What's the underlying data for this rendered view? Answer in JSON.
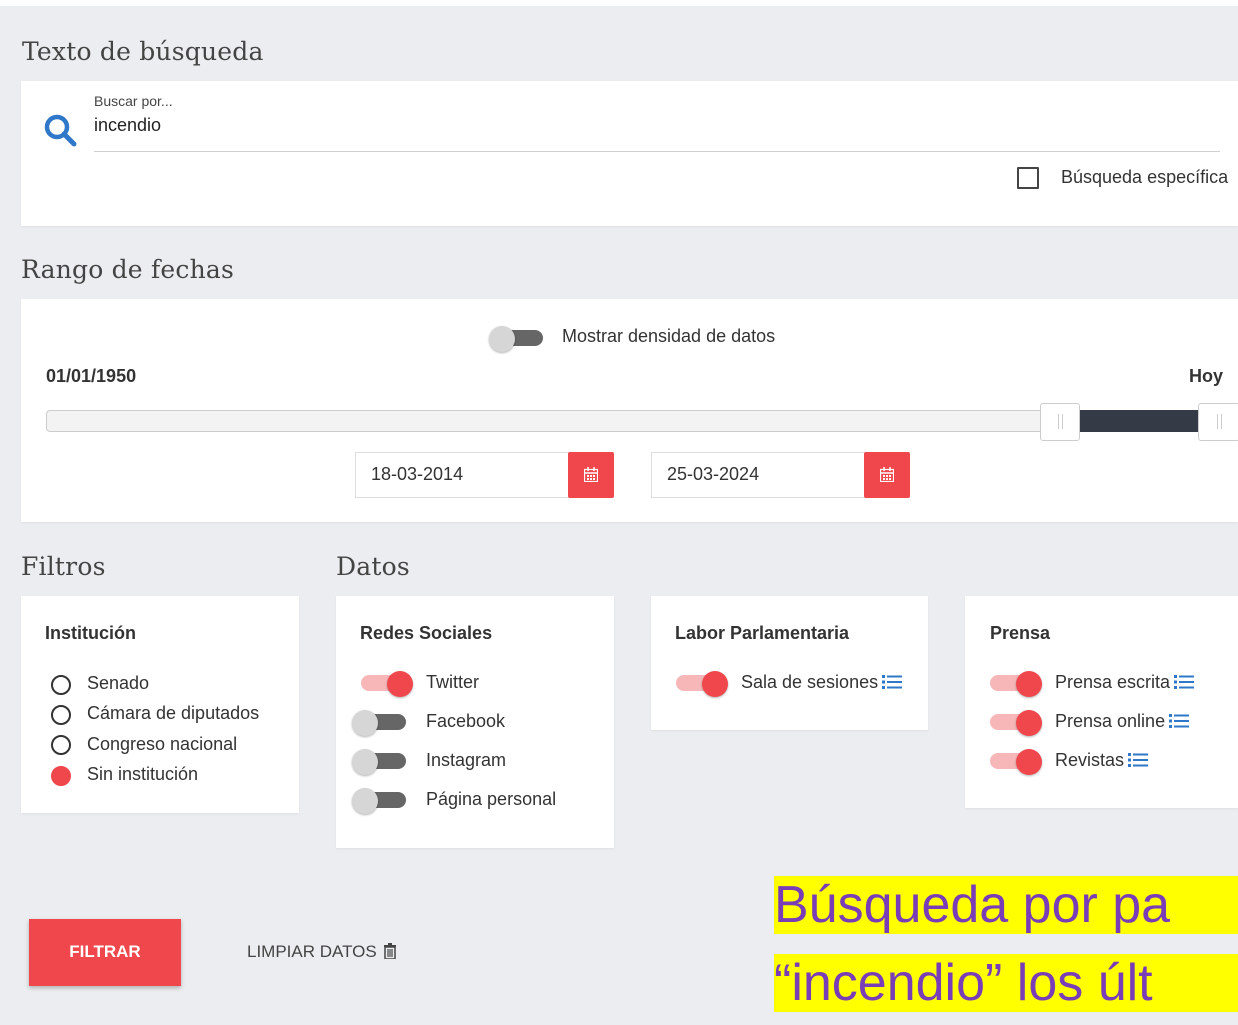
{
  "search": {
    "section_title": "Texto de búsqueda",
    "field_label": "Buscar por...",
    "value": "incendio",
    "specific_label": "Búsqueda específica"
  },
  "dates": {
    "section_title": "Rango de fechas",
    "density_label": "Mostrar densidad de datos",
    "min_label": "01/01/1950",
    "max_label": "Hoy",
    "start": "18-03-2014",
    "end": "25-03-2024"
  },
  "filters": {
    "section_title": "Filtros",
    "card_title": "Institución",
    "options": [
      "Senado",
      "Cámara de diputados",
      "Congreso nacional",
      "Sin institución"
    ],
    "selected": "Sin institución"
  },
  "datos": {
    "section_title": "Datos",
    "redes": {
      "title": "Redes Sociales",
      "items": [
        {
          "label": "Twitter",
          "on": true
        },
        {
          "label": "Facebook",
          "on": false
        },
        {
          "label": "Instagram",
          "on": false
        },
        {
          "label": "Página personal",
          "on": false
        }
      ]
    },
    "labor": {
      "title": "Labor Parlamentaria",
      "items": [
        {
          "label": "Sala de sesiones",
          "on": true
        }
      ]
    },
    "prensa": {
      "title": "Prensa",
      "items": [
        {
          "label": "Prensa escrita",
          "on": true
        },
        {
          "label": "Prensa online",
          "on": true
        },
        {
          "label": "Revistas",
          "on": true
        }
      ]
    }
  },
  "actions": {
    "filter_label": "FILTRAR",
    "clear_label": "LIMPIAR DATOS"
  },
  "caption": {
    "line1": "Búsqueda por pa",
    "line2": "“incendio” los últ"
  },
  "colors": {
    "accent": "#f0474c",
    "search_icon": "#2f78c9",
    "caption_bg": "#ffff00",
    "caption_text": "#7a3db8"
  }
}
